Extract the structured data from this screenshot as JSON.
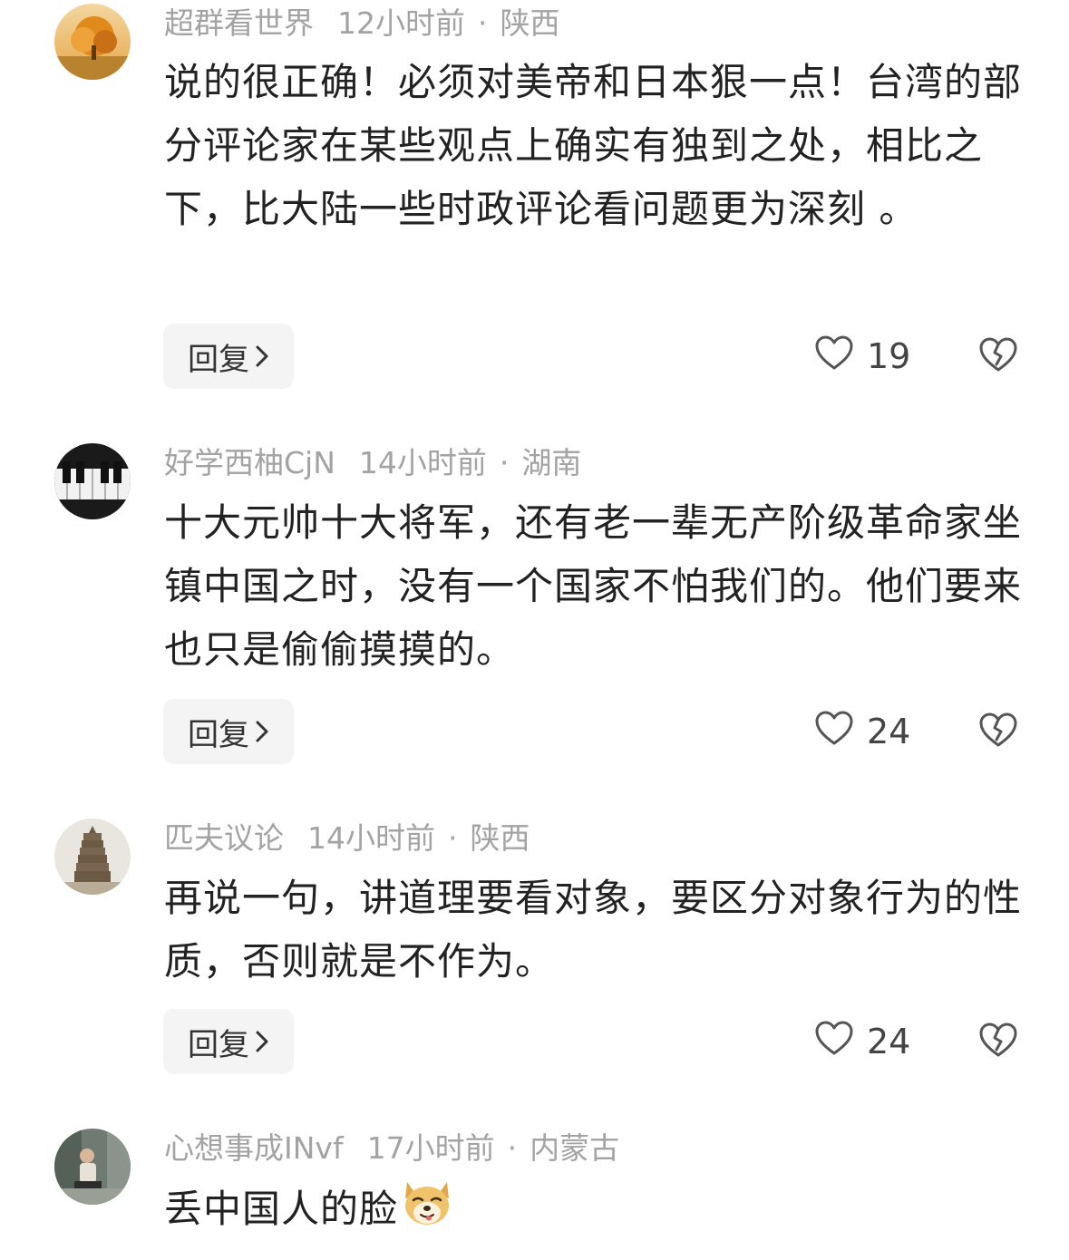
{
  "comments": [
    {
      "username": "超群看世界",
      "time": "12小时前",
      "separator": "·",
      "location": "陕西",
      "text": "说的很正确！必须对美帝和日本狠一点！台湾的部分评论家在某些观点上确实有独到之处，相比之下，比大陆一些时政评论看问题更为深刻 。",
      "reply_label": "回复",
      "likes": "19",
      "avatar_icon": "autumn-tree-avatar"
    },
    {
      "username": "好学西柚CjN",
      "time": "14小时前",
      "separator": "·",
      "location": "湖南",
      "text": "十大元帅十大将军，还有老一辈无产阶级革命家坐镇中国之时，没有一个国家不怕我们的。他们要来也只是偷偷摸摸的。",
      "reply_label": "回复",
      "likes": "24",
      "avatar_icon": "piano-keys-avatar"
    },
    {
      "username": "匹夫议论",
      "time": "14小时前",
      "separator": "·",
      "location": "陕西",
      "text": "再说一句，讲道理要看对象，要区分对象行为的性质，否则就是不作为。",
      "reply_label": "回复",
      "likes": "24",
      "avatar_icon": "pagoda-avatar"
    },
    {
      "username": "心想事成INvf",
      "time": "17小时前",
      "separator": "·",
      "location": "内蒙古",
      "text": "丢中国人的脸",
      "emoji": "doge-emoji",
      "avatar_icon": "person-photo-avatar"
    }
  ],
  "colors": {
    "meta_text": "#a3a3a3",
    "body_text": "#222222",
    "reply_bg": "#f4f4f4",
    "icon_stroke": "#555555"
  }
}
